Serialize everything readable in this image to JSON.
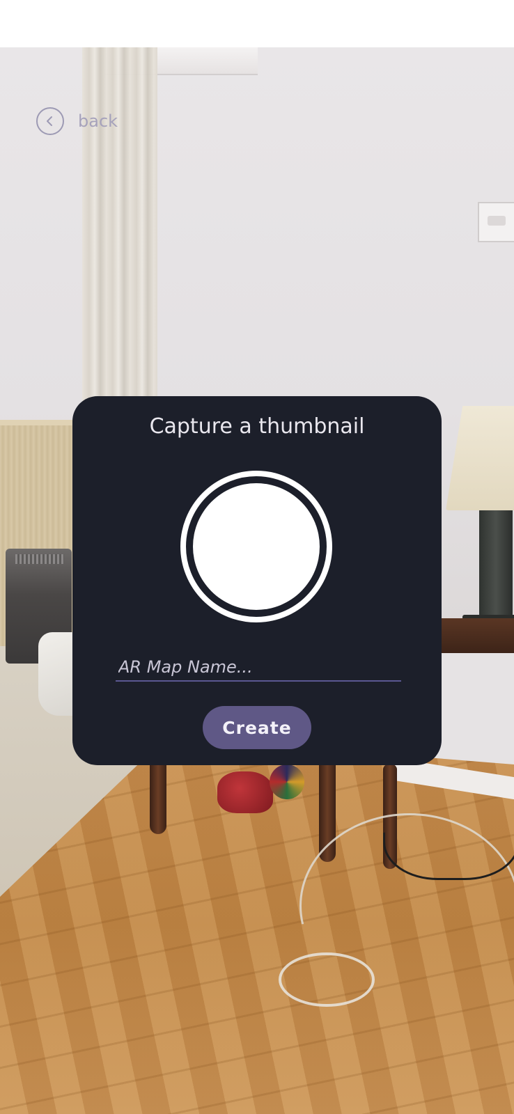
{
  "back": {
    "label": "back",
    "icon": "chevron-left-icon"
  },
  "dialog": {
    "title": "Capture a thumbnail",
    "capture_icon": "shutter-icon",
    "map_name_value": "",
    "map_name_placeholder": "AR Map Name...",
    "create_label": "Create"
  },
  "colors": {
    "dialog_background": "#1c1f2a",
    "accent": "#5f5886",
    "input_underline": "#5b5892",
    "text_light": "#e9e7ee"
  }
}
